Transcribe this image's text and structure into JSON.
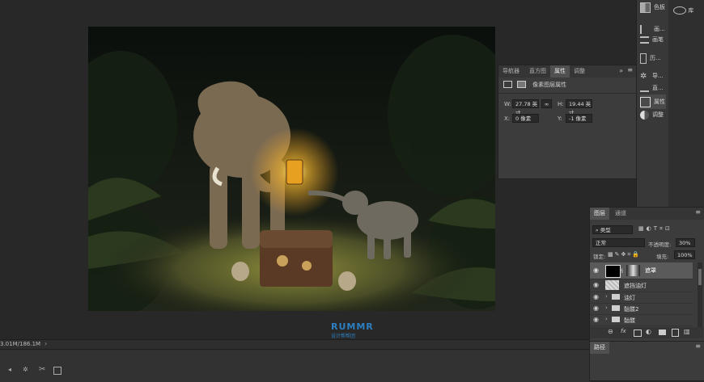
{
  "status_bar": {
    "doc_size": "3.01M/186.1M"
  },
  "right_dock": {
    "top_items": [
      {
        "label": "色板",
        "icon": "swatches-icon"
      },
      {
        "label": "画...",
        "icon": "brush-icon"
      },
      {
        "label": "画笔",
        "icon": "brush-settings-icon"
      },
      {
        "label": "历...",
        "icon": "history-icon"
      },
      {
        "label": "导...",
        "icon": "navigator-icon"
      },
      {
        "label": "直...",
        "icon": "histogram-icon"
      },
      {
        "label": "属性",
        "icon": "properties-icon"
      },
      {
        "label": "调整",
        "icon": "adjustments-icon"
      }
    ],
    "library_label": "库"
  },
  "properties_panel": {
    "tabs": [
      "导航器",
      "直方图",
      "属性",
      "调整"
    ],
    "active_tab": "属性",
    "header": "像素图层属性",
    "w_label": "W:",
    "w_value": "27.78 英寸",
    "link_icon": "link-icon",
    "h_label": "H:",
    "h_value": "19.44 英寸",
    "x_label": "X:",
    "x_value": "0 像素",
    "y_label": "Y:",
    "y_value": "-1 像素"
  },
  "layers_panel": {
    "tabs": [
      "图层",
      "通道"
    ],
    "active_tab": "图层",
    "filter_label": "类型",
    "blend_mode": "正常",
    "opacity_label": "不透明度:",
    "opacity_value": "30%",
    "lock_label": "锁定:",
    "fill_label": "填充:",
    "fill_value": "100%",
    "layers": [
      {
        "name": "遮罩",
        "type": "mask"
      },
      {
        "name": "遮挡油灯",
        "type": "pixel"
      },
      {
        "name": "油灯",
        "type": "group"
      },
      {
        "name": "骷髅2",
        "type": "group"
      },
      {
        "name": "骷髅",
        "type": "group"
      }
    ]
  },
  "paths_panel": {
    "tab": "路径"
  },
  "watermark": {
    "text": "RUMMR",
    "sub": "设计帮帮团"
  },
  "colors": {
    "bg": "#282828",
    "panel": "#3c3c3c",
    "active_tab": "#505050",
    "selected_layer": "#5a5a5a"
  }
}
